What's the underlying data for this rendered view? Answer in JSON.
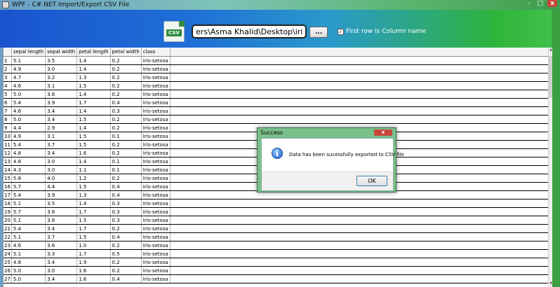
{
  "window": {
    "title": "WPF - C#.NET Import/Export CSV File",
    "controls": {
      "minimize": "–",
      "maximize": "□",
      "close": "x"
    }
  },
  "toolbar": {
    "csv_icon_label": "CSV",
    "file_path": "ers\\Asma Khalid\\Desktop\\iris.csv",
    "browse_label": "...",
    "first_row_checked": "✓",
    "first_row_label": "First row is Column name"
  },
  "grid": {
    "columns": [
      "sepal length",
      "sepal width",
      "petal length",
      "petal width",
      "class"
    ],
    "rows": [
      [
        "1",
        "5.1",
        "3.5",
        "1.4",
        "0.2",
        "Iris-setosa"
      ],
      [
        "2",
        "4.9",
        "3.0",
        "1.4",
        "0.2",
        "Iris-setosa"
      ],
      [
        "3",
        "4.7",
        "3.2",
        "1.3",
        "0.2",
        "Iris-setosa"
      ],
      [
        "4",
        "4.6",
        "3.1",
        "1.5",
        "0.2",
        "Iris-setosa"
      ],
      [
        "5",
        "5.0",
        "3.6",
        "1.4",
        "0.2",
        "Iris-setosa"
      ],
      [
        "6",
        "5.4",
        "3.9",
        "1.7",
        "0.4",
        "Iris-setosa"
      ],
      [
        "7",
        "4.6",
        "3.4",
        "1.4",
        "0.3",
        "Iris-setosa"
      ],
      [
        "8",
        "5.0",
        "3.4",
        "1.5",
        "0.2",
        "Iris-setosa"
      ],
      [
        "9",
        "4.4",
        "2.9",
        "1.4",
        "0.2",
        "Iris-setosa"
      ],
      [
        "10",
        "4.9",
        "3.1",
        "1.5",
        "0.1",
        "Iris-setosa"
      ],
      [
        "11",
        "5.4",
        "3.7",
        "1.5",
        "0.2",
        "Iris-setosa"
      ],
      [
        "12",
        "4.8",
        "3.4",
        "1.6",
        "0.2",
        "Iris-setosa"
      ],
      [
        "13",
        "4.8",
        "3.0",
        "1.4",
        "0.1",
        "Iris-setosa"
      ],
      [
        "14",
        "4.3",
        "3.0",
        "1.1",
        "0.1",
        "Iris-setosa"
      ],
      [
        "15",
        "5.8",
        "4.0",
        "1.2",
        "0.2",
        "Iris-setosa"
      ],
      [
        "16",
        "5.7",
        "4.4",
        "1.5",
        "0.4",
        "Iris-setosa"
      ],
      [
        "17",
        "5.4",
        "3.9",
        "1.3",
        "0.4",
        "Iris-setosa"
      ],
      [
        "18",
        "5.1",
        "3.5",
        "1.4",
        "0.3",
        "Iris-setosa"
      ],
      [
        "19",
        "5.7",
        "3.8",
        "1.7",
        "0.3",
        "Iris-setosa"
      ],
      [
        "20",
        "5.1",
        "3.8",
        "1.5",
        "0.3",
        "Iris-setosa"
      ],
      [
        "21",
        "5.4",
        "3.4",
        "1.7",
        "0.2",
        "Iris-setosa"
      ],
      [
        "22",
        "5.1",
        "3.7",
        "1.5",
        "0.4",
        "Iris-setosa"
      ],
      [
        "23",
        "4.6",
        "3.6",
        "1.0",
        "0.2",
        "Iris-setosa"
      ],
      [
        "24",
        "5.1",
        "3.3",
        "1.7",
        "0.5",
        "Iris-setosa"
      ],
      [
        "25",
        "4.8",
        "3.4",
        "1.9",
        "0.2",
        "Iris-setosa"
      ],
      [
        "26",
        "5.0",
        "3.0",
        "1.6",
        "0.2",
        "Iris-setosa"
      ],
      [
        "27",
        "5.0",
        "3.4",
        "1.6",
        "0.4",
        "Iris-setosa"
      ]
    ]
  },
  "dialog": {
    "title": "Success",
    "close": "x",
    "icon": "i",
    "message": "Data has been sucessfully exported to CSV file",
    "ok_label": "OK"
  },
  "scrollbar": {
    "up": "▲",
    "down": "▼"
  }
}
